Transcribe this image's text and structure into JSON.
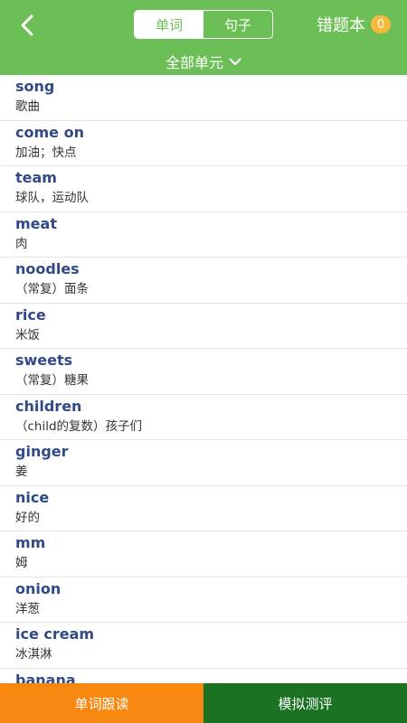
{
  "header": {
    "tabs": [
      {
        "label": "单词",
        "active": true
      },
      {
        "label": "句子",
        "active": false
      }
    ],
    "wrongbook_label": "错题本",
    "wrongbook_count": "0",
    "unit_selector": "全部单元",
    "colors": {
      "header_bg": "#6cbf56",
      "badge": "#f7b83b"
    }
  },
  "words": [
    {
      "word": "song",
      "meaning": "歌曲"
    },
    {
      "word": "come on",
      "meaning": "加油；快点"
    },
    {
      "word": "team",
      "meaning": "球队，运动队"
    },
    {
      "word": "meat",
      "meaning": "肉"
    },
    {
      "word": "noodles",
      "meaning": "（常复）面条"
    },
    {
      "word": "rice",
      "meaning": "米饭"
    },
    {
      "word": "sweets",
      "meaning": "（常复）糖果"
    },
    {
      "word": "children",
      "meaning": "（child的复数）孩子们"
    },
    {
      "word": "ginger",
      "meaning": "姜"
    },
    {
      "word": "nice",
      "meaning": "好的"
    },
    {
      "word": "mm",
      "meaning": "姆"
    },
    {
      "word": "onion",
      "meaning": "洋葱"
    },
    {
      "word": "ice cream",
      "meaning": "冰淇淋"
    },
    {
      "word": "banana",
      "meaning": ""
    }
  ],
  "footer": {
    "left_label": "单词跟读",
    "right_label": "模拟测评",
    "colors": {
      "left": "#f7870f",
      "right": "#1b7223"
    }
  },
  "icons": {
    "back": "chevron-left-icon",
    "unit_dropdown": "chevron-down-icon"
  }
}
